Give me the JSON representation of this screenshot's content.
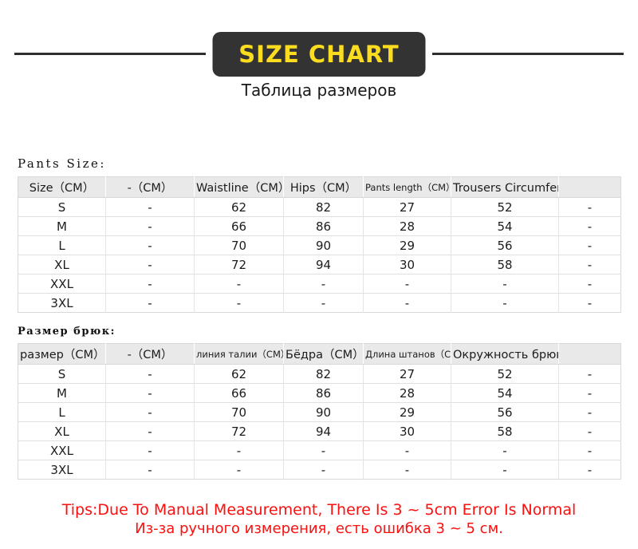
{
  "header": {
    "badge_label": "SIZE CHART",
    "subtitle": "Таблица размеров",
    "badge_bg": "#333333",
    "badge_text_color": "#fcdc1e",
    "rule_color": "#2e2e2e"
  },
  "sections": [
    {
      "title": "Pants Size:",
      "table": {
        "headers": [
          "Size（CM）",
          "-（CM）",
          "Waistline（CM）",
          "Hips（CM）",
          "Pants length（CM）",
          "Trousers Circumference（CM）",
          ""
        ],
        "narrow_header_index": 4,
        "rows": [
          [
            "S",
            "-",
            "62",
            "82",
            "27",
            "52",
            "-"
          ],
          [
            "M",
            "-",
            "66",
            "86",
            "28",
            "54",
            "-"
          ],
          [
            "L",
            "-",
            "70",
            "90",
            "29",
            "56",
            "-"
          ],
          [
            "XL",
            "-",
            "72",
            "94",
            "30",
            "58",
            "-"
          ],
          [
            "XXL",
            "-",
            "-",
            "-",
            "-",
            "-",
            "-"
          ],
          [
            "3XL",
            "-",
            "-",
            "-",
            "-",
            "-",
            "-"
          ]
        ]
      }
    },
    {
      "title": "Размер брюк:",
      "table": {
        "headers": [
          "размер（CM）",
          "-（CM）",
          "линия талии（CM）",
          "Бёдра（CM）",
          "Длина штанов（CM）",
          "Окружность брюк（CM）",
          ""
        ],
        "narrow_header_index": 4,
        "rows": [
          [
            "S",
            "-",
            "62",
            "82",
            "27",
            "52",
            "-"
          ],
          [
            "M",
            "-",
            "66",
            "86",
            "28",
            "54",
            "-"
          ],
          [
            "L",
            "-",
            "70",
            "90",
            "29",
            "56",
            "-"
          ],
          [
            "XL",
            "-",
            "72",
            "94",
            "30",
            "58",
            "-"
          ],
          [
            "XXL",
            "-",
            "-",
            "-",
            "-",
            "-",
            "-"
          ],
          [
            "3XL",
            "-",
            "-",
            "-",
            "-",
            "-",
            "-"
          ]
        ]
      }
    }
  ],
  "tips": {
    "line_en": "Tips:Due To Manual Measurement, There Is 3 ~ 5cm Error Is Normal",
    "line_ru": "Из-за ручного измерения, есть ошибка 3 ~ 5 см.",
    "color": "#fb0f0f"
  }
}
